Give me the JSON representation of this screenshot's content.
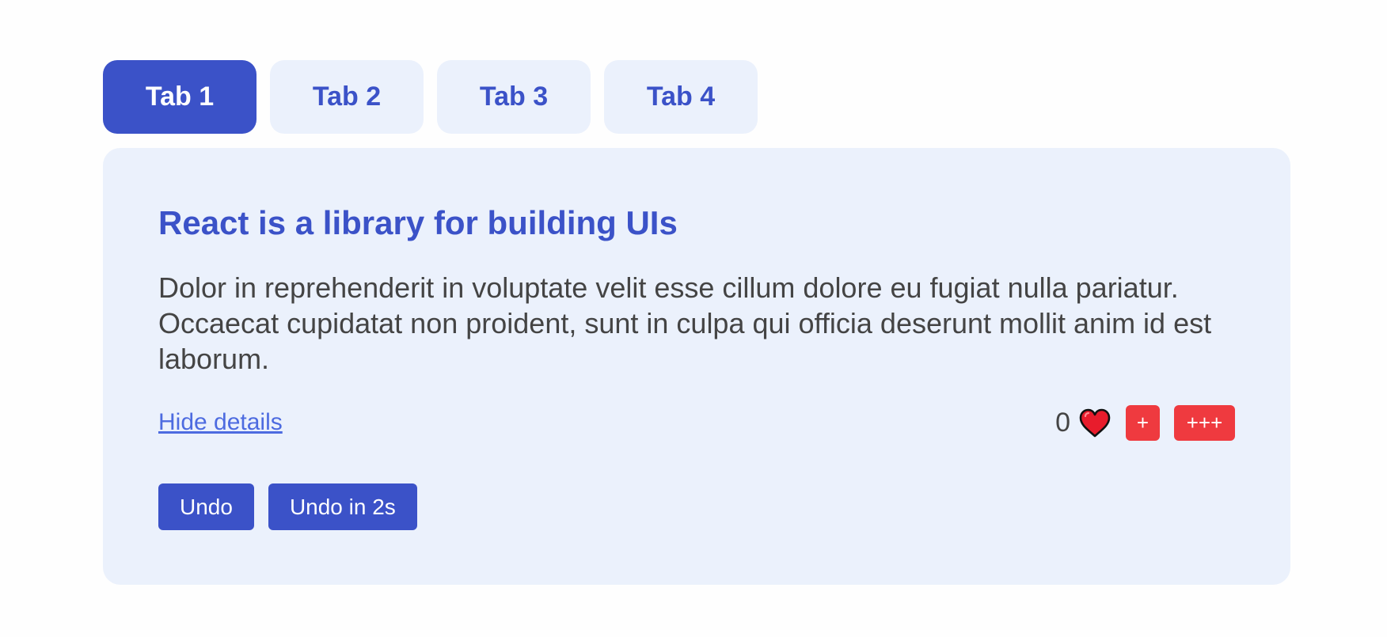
{
  "tabs": [
    {
      "label": "Tab 1",
      "active": true
    },
    {
      "label": "Tab 2",
      "active": false
    },
    {
      "label": "Tab 3",
      "active": false
    },
    {
      "label": "Tab 4",
      "active": false
    }
  ],
  "panel": {
    "title": "React is a library for building UIs",
    "body": "Dolor in reprehenderit in voluptate velit esse cillum dolore eu fugiat nulla pariatur. Occaecat cupidatat non proident, sunt in culpa qui officia deserunt mollit anim id est laborum.",
    "details_link": "Hide details",
    "like_count": "0",
    "like_icon": "heart-icon",
    "like_plus_label": "+",
    "like_triple_label": "+++",
    "undo_label": "Undo",
    "undo_delay_label": "Undo in 2s"
  },
  "colors": {
    "accent": "#3b52c8",
    "panel_bg": "#ebf1fc",
    "like_button": "#ef3a3f",
    "link": "#4d6be0",
    "body_text": "#444444"
  }
}
